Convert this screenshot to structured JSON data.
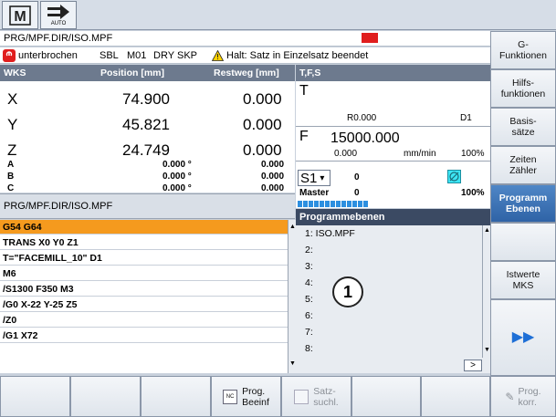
{
  "topbar": {
    "mode_label": "AUTO"
  },
  "path_bar": {
    "path": "PRG/MPF.DIR/ISO.MPF"
  },
  "status_bar": {
    "state": "unterbrochen",
    "sbl": "SBL",
    "m01": "M01",
    "dry": "DRY",
    "skp": "SKP",
    "message": "Halt: Satz in Einzelsatz beendet"
  },
  "wks_table": {
    "headers": {
      "name": "WKS",
      "position": "Position [mm]",
      "restweg": "Restweg [mm]"
    },
    "axes": [
      {
        "name": "X",
        "position": "74.900",
        "restweg": "0.000"
      },
      {
        "name": "Y",
        "position": "45.821",
        "restweg": "0.000"
      },
      {
        "name": "Z",
        "position": "24.749",
        "restweg": "0.000"
      },
      {
        "name": "A",
        "position": "0.000 °",
        "restweg": "0.000"
      },
      {
        "name": "B",
        "position": "0.000 °",
        "restweg": "0.000"
      },
      {
        "name": "C",
        "position": "0.000 °",
        "restweg": "0.000"
      }
    ]
  },
  "tfs": {
    "header": "T,F,S",
    "t_label": "T",
    "r_value": "R0.000",
    "d_value": "D1",
    "f_label": "F",
    "f_value": "15000.000",
    "f_actual": "0.000",
    "f_unit": "mm/min",
    "f_override": "100%",
    "spindle": "S1",
    "spindle_value": "0",
    "master_label": "Master",
    "master_value": "0",
    "s_override": "100%"
  },
  "program": {
    "path": "PRG/MPF.DIR/ISO.MPF",
    "lines": [
      "G54 G64",
      "TRANS X0 Y0 Z1",
      "T=\"FACEMILL_10\" D1",
      "M6",
      "/S1300 F350 M3",
      "/G0 X-22 Y-25 Z5",
      "/Z0",
      "/G1 X72"
    ]
  },
  "levels": {
    "title": "Programmebenen",
    "items": [
      "1: ISO.MPF",
      "2:",
      "3:",
      "4:",
      "5:",
      "6:",
      "7:",
      "8:"
    ],
    "callout": "1",
    "more": ">"
  },
  "softkeys_right": [
    {
      "label": "G-\nFunktionen",
      "active": false
    },
    {
      "label": "Hilfs-\nfunktionen",
      "active": false
    },
    {
      "label": "Basis-\nsätze",
      "active": false
    },
    {
      "label": "Zeiten\nZähler",
      "active": false
    },
    {
      "label": "Programm\nEbenen",
      "active": true
    },
    {
      "label": "",
      "active": false
    },
    {
      "label": "Istwerte\nMKS",
      "active": false
    },
    {
      "label": "▶▶",
      "active": false
    }
  ],
  "softkeys_bottom": [
    {
      "label": ""
    },
    {
      "label": ""
    },
    {
      "label": ""
    },
    {
      "label": "Prog.\nBeeinf"
    },
    {
      "label": "Satz-\nsuchl."
    },
    {
      "label": ""
    },
    {
      "label": ""
    },
    {
      "label": "Prog.\nkorr."
    }
  ],
  "colors": {
    "highlight": "#f59a1e",
    "header_blue": "#3b4a63",
    "active_softkey": "#2f63a6",
    "alarm_red": "#e01e1e"
  }
}
